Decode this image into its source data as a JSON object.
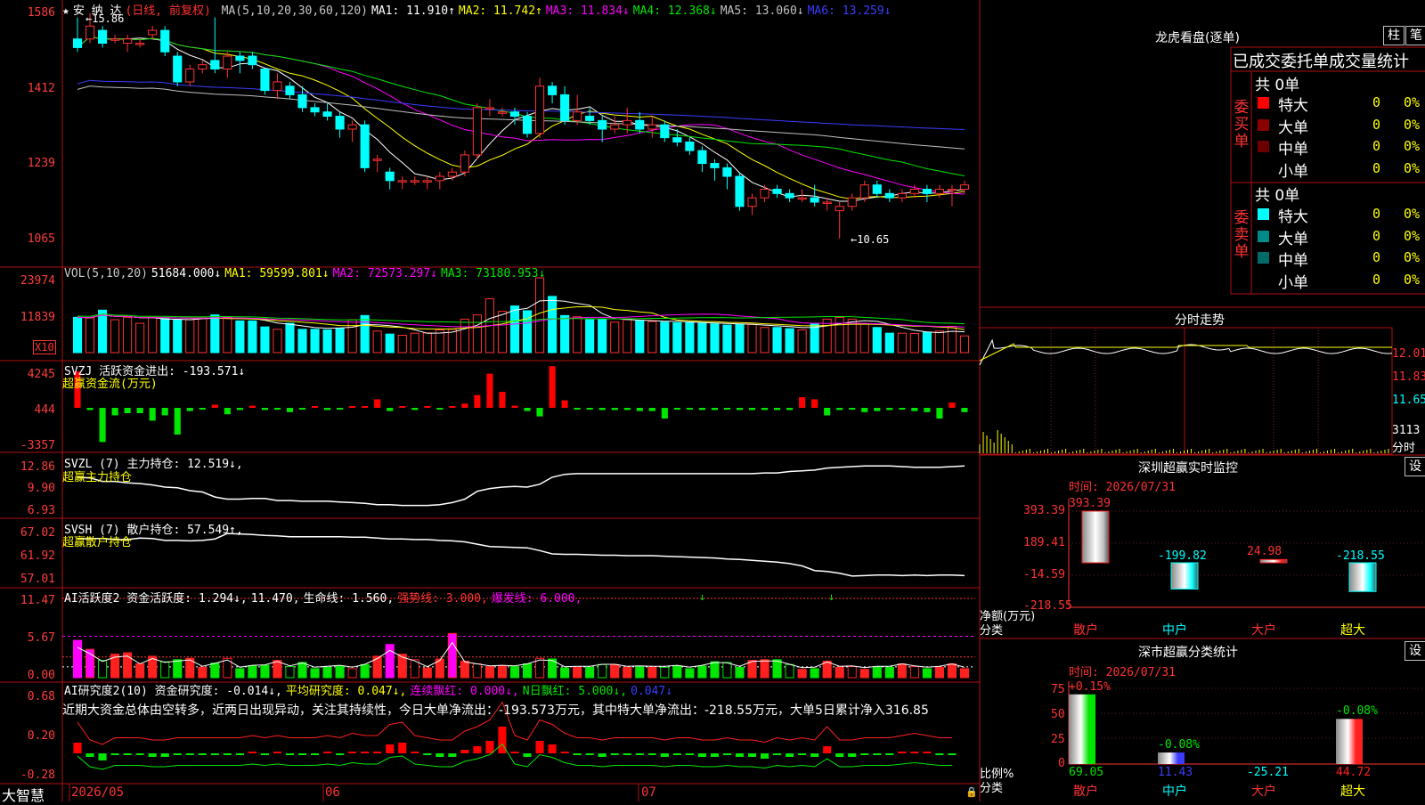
{
  "stock": {
    "star": "★",
    "name": "安 纳 达",
    "period": "(日线, 前复权)"
  },
  "ma_line": [
    {
      "label": "MA(5,10,20,30,60,120)",
      "color": "#c8c8c8"
    },
    {
      "label": "MA1: 11.910↑",
      "color": "#ffffff"
    },
    {
      "label": "MA2: 11.742↑",
      "color": "#ffff00"
    },
    {
      "label": "MA3: 11.834↓",
      "color": "#ff00ff"
    },
    {
      "label": "MA4: 12.368↓",
      "color": "#00e600"
    },
    {
      "label": "MA5: 13.060↓",
      "color": "#c0c0c0"
    },
    {
      "label": "MA6: 13.259↓",
      "color": "#3c3cff"
    }
  ],
  "price_axis": [
    "1586",
    "1412",
    "1239",
    "1065"
  ],
  "price_hi": "15.86",
  "price_lo": "10.65",
  "vol_line": [
    {
      "label": "VOL(5,10,20)",
      "color": "#c8c8c8"
    },
    {
      "label": "51684.000↓",
      "color": "#ffffff"
    },
    {
      "label": "MA1: 59599.801↓",
      "color": "#ffff00"
    },
    {
      "label": "MA2: 72573.297↓",
      "color": "#ff00ff"
    },
    {
      "label": "MA3: 73180.953↓",
      "color": "#00e600"
    }
  ],
  "vol_axis": [
    "23974",
    "11839"
  ],
  "vol_unit": "X10",
  "svzj_line": [
    {
      "label": "SVZJ  活跃资金进出: -193.571↓",
      "color": "#ffffff"
    }
  ],
  "svzj_sub": "超赢资金流(万元)",
  "svzj_axis": [
    "4245",
    "444",
    "-3357"
  ],
  "svzl_line": [
    {
      "label": "SVZL (7) 主力持仓: 12.519↓,",
      "color": "#ffffff"
    }
  ],
  "svzl_sub": "超赢主力持仓",
  "svzl_axis": [
    "12.86",
    "9.90",
    "6.93"
  ],
  "svsh_line": [
    {
      "label": "SVSH (7) 散户持仓: 57.549↑,",
      "color": "#ffffff"
    }
  ],
  "svsh_sub": "超赢散户持仓",
  "svsh_axis": [
    "67.02",
    "61.92",
    "57.01"
  ],
  "ai1_line": [
    {
      "label": "AI活跃度2 资金活跃度: 1.294↓,",
      "color": "#ffffff"
    },
    {
      "label": "11.470,",
      "color": "#ffffff"
    },
    {
      "label": "生命线: 1.560,",
      "color": "#ffffff"
    },
    {
      "label": "强势线: 3.000,",
      "color": "#ff3232"
    },
    {
      "label": "爆发线: 6.000,",
      "color": "#ff00ff"
    }
  ],
  "ai1_axis": [
    "11.47",
    "5.67",
    "0.00"
  ],
  "ai2_line": [
    {
      "label": "AI研究度2(10) 资金研究度: -0.014↓,",
      "color": "#ffffff"
    },
    {
      "label": "平均研究度: 0.047↓,",
      "color": "#ffff00"
    },
    {
      "label": "连续飘红: 0.000↓,",
      "color": "#ff00ff"
    },
    {
      "label": "N日飘红: 5.000↓,",
      "color": "#00e600"
    },
    {
      "label": "0.047↓",
      "color": "#3c3cff"
    }
  ],
  "ai2_text": "近期大资金总体由空转多，近两日出现异动，关注其持续性，今日大单净流出：-193.573万元，其中特大单净流出：-218.55万元，大单5日累计净入316.85",
  "ai2_axis": [
    "0.68",
    "0.20",
    "-0.28"
  ],
  "bottom": {
    "brand": "大智慧",
    "d1": "2026/05",
    "d2": "06",
    "d3": "07"
  },
  "lhb": {
    "title": "龙虎看盘(逐单)",
    "btn1": "柱",
    "btn2": "笔",
    "header": "已成交委托单成交量统计",
    "buy_side": "委买单",
    "sell_side": "委卖单",
    "buy_total": "共 0单",
    "sell_total": "共 0单",
    "buy_rows": [
      {
        "label": "特大",
        "color": "#ff0000",
        "n": "0",
        "p": "0%"
      },
      {
        "label": "大单",
        "color": "#8b0000",
        "n": "0",
        "p": "0%"
      },
      {
        "label": "中单",
        "color": "#6b0000",
        "n": "0",
        "p": "0%"
      },
      {
        "label": "小单",
        "color": "#000000",
        "n": "0",
        "p": "0%"
      }
    ],
    "sell_rows": [
      {
        "label": "特大",
        "color": "#00ffff",
        "n": "0",
        "p": "0%"
      },
      {
        "label": "大单",
        "color": "#008b8b",
        "n": "0",
        "p": "0%"
      },
      {
        "label": "中单",
        "color": "#006b6b",
        "n": "0",
        "p": "0%"
      },
      {
        "label": "小单",
        "color": "#000000",
        "n": "0",
        "p": "0%"
      }
    ]
  },
  "fenshi": {
    "title": "分时走势",
    "y1": "12.01",
    "y2": "11.83",
    "y3": "11.65",
    "vol": "3113",
    "unit": "分时"
  },
  "sz_monitor": {
    "title": "深圳超赢实时监控",
    "btn": "设",
    "time": "时间: 2026/07/31",
    "axis": [
      "393.39",
      "189.41",
      "-14.59",
      "-218.55"
    ],
    "ylab1": "净额(万元)",
    "ylab2": "分类",
    "bars": [
      {
        "cat": "散户",
        "value": "393.39"
      },
      {
        "cat": "中户",
        "value": "-199.82"
      },
      {
        "cat": "大户",
        "value": "24.98"
      },
      {
        "cat": "超大",
        "value": "-218.55"
      }
    ]
  },
  "sz_class": {
    "title": "深市超赢分类统计",
    "btn": "设",
    "time": "时间: 2026/07/31",
    "axis": [
      "75",
      "50",
      "25",
      "0"
    ],
    "ylab1": "比例%",
    "ylab2": "分类",
    "bars": [
      {
        "cat": "散户",
        "top": "+0.15%",
        "bottom": "69.05"
      },
      {
        "cat": "中户",
        "top": "-0.08%",
        "bottom": "11.43"
      },
      {
        "cat": "大户",
        "top": "",
        "bottom": "-25.21"
      },
      {
        "cat": "超大",
        "top": "-0.08%",
        "bottom": "44.72"
      }
    ]
  },
  "chart_data": {
    "type": "candlestick",
    "candles": [
      [
        15.3,
        15.1,
        15.8,
        15.0
      ],
      [
        15.3,
        15.6,
        15.9,
        15.2
      ],
      [
        15.5,
        15.2,
        15.6,
        15.1
      ],
      [
        15.3,
        15.3,
        15.4,
        15.2
      ],
      [
        15.2,
        15.3,
        15.4,
        15.0
      ],
      [
        15.2,
        15.2,
        15.3,
        15.1
      ],
      [
        15.4,
        15.5,
        15.6,
        15.3
      ],
      [
        15.5,
        15.0,
        15.6,
        14.9
      ],
      [
        14.9,
        14.3,
        15.0,
        14.2
      ],
      [
        14.3,
        14.6,
        14.7,
        14.2
      ],
      [
        14.6,
        14.7,
        14.8,
        14.5
      ],
      [
        14.8,
        14.6,
        15.8,
        14.5
      ],
      [
        14.6,
        14.9,
        15.0,
        14.4
      ],
      [
        14.9,
        14.8,
        15.0,
        14.5
      ],
      [
        14.9,
        14.7,
        15.0,
        14.6
      ],
      [
        14.6,
        14.1,
        14.6,
        14.0
      ],
      [
        14.1,
        14.3,
        14.5,
        13.9
      ],
      [
        14.2,
        14.0,
        14.3,
        13.9
      ],
      [
        14.0,
        13.7,
        14.2,
        13.6
      ],
      [
        13.7,
        13.6,
        13.8,
        13.5
      ],
      [
        13.6,
        13.5,
        13.8,
        13.4
      ],
      [
        13.5,
        13.2,
        13.6,
        13.0
      ],
      [
        13.2,
        13.3,
        13.4,
        12.9
      ],
      [
        13.3,
        12.3,
        13.4,
        12.2
      ],
      [
        12.5,
        12.5,
        12.6,
        12.2
      ],
      [
        12.2,
        12.0,
        12.3,
        11.8
      ],
      [
        12.0,
        12.0,
        12.1,
        11.8
      ],
      [
        12.0,
        12.0,
        12.1,
        11.9
      ],
      [
        12.0,
        12.0,
        12.1,
        11.8
      ],
      [
        12.0,
        12.1,
        12.2,
        11.8
      ],
      [
        12.1,
        12.2,
        12.3,
        12.0
      ],
      [
        12.2,
        12.6,
        12.7,
        12.1
      ],
      [
        12.6,
        13.7,
        13.8,
        12.5
      ],
      [
        13.7,
        13.7,
        13.9,
        13.5
      ],
      [
        13.6,
        13.6,
        13.7,
        13.5
      ],
      [
        13.6,
        13.5,
        13.7,
        13.3
      ],
      [
        13.5,
        13.1,
        13.6,
        13.0
      ],
      [
        13.1,
        14.2,
        14.4,
        13.0
      ],
      [
        14.2,
        14.0,
        14.3,
        13.8
      ],
      [
        14.0,
        13.4,
        14.2,
        13.3
      ],
      [
        13.4,
        13.6,
        14.0,
        13.3
      ],
      [
        13.5,
        13.4,
        13.7,
        13.3
      ],
      [
        13.4,
        13.2,
        13.5,
        12.9
      ],
      [
        13.2,
        13.3,
        13.5,
        13.1
      ],
      [
        13.3,
        13.4,
        13.7,
        13.1
      ],
      [
        13.4,
        13.2,
        13.6,
        13.1
      ],
      [
        13.2,
        13.3,
        13.5,
        13.0
      ],
      [
        13.3,
        13.0,
        13.4,
        12.9
      ],
      [
        13.0,
        12.9,
        13.2,
        12.8
      ],
      [
        12.9,
        12.7,
        13.0,
        12.6
      ],
      [
        12.7,
        12.4,
        12.8,
        12.2
      ],
      [
        12.4,
        12.3,
        12.5,
        12.0
      ],
      [
        12.3,
        12.1,
        12.4,
        11.8
      ],
      [
        12.1,
        11.4,
        12.2,
        11.3
      ],
      [
        11.4,
        11.6,
        11.7,
        11.2
      ],
      [
        11.6,
        11.8,
        11.9,
        11.5
      ],
      [
        11.8,
        11.7,
        11.9,
        11.6
      ],
      [
        11.7,
        11.6,
        11.8,
        11.5
      ],
      [
        11.6,
        11.6,
        11.8,
        11.5
      ],
      [
        11.6,
        11.5,
        11.9,
        11.4
      ],
      [
        11.5,
        11.5,
        11.6,
        11.3
      ],
      [
        11.3,
        11.4,
        11.5,
        10.65
      ],
      [
        11.4,
        11.6,
        11.7,
        11.3
      ],
      [
        11.6,
        11.9,
        12.0,
        11.5
      ],
      [
        11.9,
        11.7,
        12.0,
        11.6
      ],
      [
        11.7,
        11.6,
        11.8,
        11.5
      ],
      [
        11.6,
        11.7,
        11.8,
        11.5
      ],
      [
        11.7,
        11.8,
        11.9,
        11.6
      ],
      [
        11.8,
        11.7,
        11.9,
        11.5
      ],
      [
        11.7,
        11.8,
        11.9,
        11.6
      ],
      [
        11.8,
        11.8,
        11.9,
        11.4
      ],
      [
        11.8,
        11.9,
        12.0,
        11.7
      ]
    ],
    "volume": [
      11.8,
      11.6,
      14.2,
      11.0,
      11.8,
      9.8,
      11.8,
      11.5,
      10.9,
      11.0,
      11.5,
      12.6,
      11.8,
      10.6,
      10.6,
      8.6,
      7.8,
      9.8,
      7.8,
      7.8,
      7.6,
      8.2,
      11.0,
      12.4,
      7.2,
      6.2,
      5.8,
      6.5,
      6.6,
      7.6,
      7.8,
      11.2,
      12.6,
      18.0,
      13.8,
      15.6,
      14.0,
      25.0,
      18.8,
      12.4,
      12.0,
      11.0,
      11.2,
      10.2,
      11.0,
      10.8,
      10.4,
      10.2,
      10.0,
      10.0,
      9.8,
      9.6,
      9.2,
      9.4,
      9.4,
      8.4,
      8.4,
      8.0,
      7.6,
      9.6,
      11.2,
      11.8,
      11.2,
      9.6,
      8.4,
      6.5,
      6.5,
      6.4,
      6.8,
      7.2,
      8.8,
      5.6
    ],
    "money": [
      3400,
      -200,
      -3200,
      -700,
      -500,
      -500,
      -1200,
      -700,
      -2500,
      -300,
      -100,
      300,
      -600,
      -200,
      200,
      -200,
      -100,
      -400,
      -100,
      0,
      -200,
      -100,
      0,
      100,
      800,
      -300,
      0,
      -200,
      0,
      -100,
      100,
      400,
      1200,
      3200,
      1500,
      200,
      -300,
      -800,
      3900,
      700,
      -100,
      -100,
      -200,
      -200,
      -200,
      -300,
      -300,
      -1000,
      -100,
      -100,
      -200,
      -200,
      -100,
      -200,
      -200,
      -200,
      -200,
      -200,
      1000,
      800,
      -700,
      -200,
      -100,
      -400,
      -300,
      -200,
      -100,
      -300,
      -400,
      -1000,
      500,
      -400
    ],
    "zl": [
      11.2,
      11.1,
      10.6,
      10.6,
      10.4,
      10.3,
      10.1,
      9.8,
      9.7,
      9.3,
      9.1,
      8.4,
      8.1,
      8.1,
      8.2,
      8.2,
      7.9,
      7.9,
      7.8,
      7.8,
      7.8,
      7.7,
      7.6,
      7.5,
      7.3,
      7.3,
      7.2,
      7.2,
      7.2,
      7.3,
      7.6,
      8.1,
      9.2,
      9.6,
      9.8,
      9.9,
      9.8,
      10.2,
      11.2,
      11.6,
      11.7,
      11.7,
      11.7,
      11.7,
      11.7,
      11.7,
      11.7,
      11.7,
      11.7,
      11.7,
      11.7,
      11.7,
      11.7,
      11.7,
      11.7,
      11.8,
      11.8,
      12.0,
      12.1,
      12.2,
      12.5,
      12.6,
      12.7,
      12.8,
      12.8,
      12.8,
      12.7,
      12.6,
      12.6,
      12.6,
      12.7,
      12.8
    ],
    "sh": [
      65.4,
      65.5,
      65.5,
      65.3,
      65.3,
      65.6,
      65.5,
      65.1,
      65.1,
      65.0,
      65.1,
      65.4,
      66.6,
      66.5,
      66.4,
      66.2,
      66.1,
      65.9,
      65.9,
      65.9,
      65.9,
      65.9,
      65.8,
      65.8,
      65.6,
      65.4,
      65.4,
      65.3,
      65.3,
      65.1,
      65.0,
      64.8,
      64.3,
      63.8,
      63.7,
      63.6,
      63.5,
      62.9,
      62.2,
      62.1,
      62.1,
      62.0,
      61.9,
      61.9,
      61.8,
      61.8,
      61.8,
      61.7,
      61.6,
      61.5,
      61.4,
      61.3,
      61.1,
      61.0,
      60.8,
      60.6,
      60.4,
      60.1,
      59.6,
      58.6,
      58.4,
      58.0,
      57.4,
      57.5,
      57.6,
      57.6,
      57.5,
      57.6,
      57.5,
      57.6,
      57.6,
      57.5
    ],
    "act": [
      5.4,
      4.1,
      2.5,
      3.4,
      3.6,
      2.0,
      3.1,
      2.3,
      2.6,
      2.8,
      1.5,
      2.1,
      2.8,
      1.3,
      1.7,
      1.8,
      2.5,
      1.6,
      2.2,
      1.3,
      1.5,
      1.7,
      1.3,
      1.9,
      3.1,
      4.8,
      3.4,
      2.6,
      1.4,
      2.7,
      6.4,
      2.4,
      2.0,
      1.6,
      1.7,
      1.6,
      2.0,
      2.8,
      2.7,
      1.4,
      1.5,
      1.5,
      1.9,
      1.9,
      1.5,
      1.6,
      1.5,
      1.5,
      1.7,
      1.3,
      1.7,
      2.3,
      2.2,
      1.5,
      2.5,
      2.6,
      2.6,
      1.9,
      1.2,
      1.3,
      2.4,
      1.5,
      1.6,
      1.2,
      1.5,
      1.5,
      2.0,
      1.6,
      1.3,
      1.5,
      2.0,
      1.3
    ],
    "research": [
      0.06,
      -0.02,
      -0.04,
      -0.01,
      -0.01,
      -0.01,
      -0.02,
      -0.02,
      -0.01,
      -0.01,
      -0.01,
      -0.01,
      -0.01,
      -0.01,
      0.0,
      -0.01,
      0.0,
      -0.01,
      -0.01,
      -0.01,
      0.0,
      -0.01,
      0.01,
      0.0,
      0.0,
      0.05,
      0.06,
      0.0,
      -0.01,
      -0.02,
      -0.02,
      0.02,
      0.04,
      0.07,
      0.15,
      0.0,
      -0.02,
      0.07,
      0.05,
      0.01,
      -0.01,
      -0.01,
      -0.02,
      -0.01,
      -0.01,
      -0.01,
      -0.01,
      -0.02,
      -0.01,
      -0.01,
      -0.02,
      -0.02,
      -0.01,
      -0.02,
      -0.02,
      -0.03,
      -0.01,
      -0.02,
      -0.01,
      -0.02,
      0.04,
      -0.02,
      -0.02,
      -0.01,
      -0.01,
      -0.01,
      0.0,
      0.01,
      0.0,
      -0.01,
      -0.01
    ]
  }
}
